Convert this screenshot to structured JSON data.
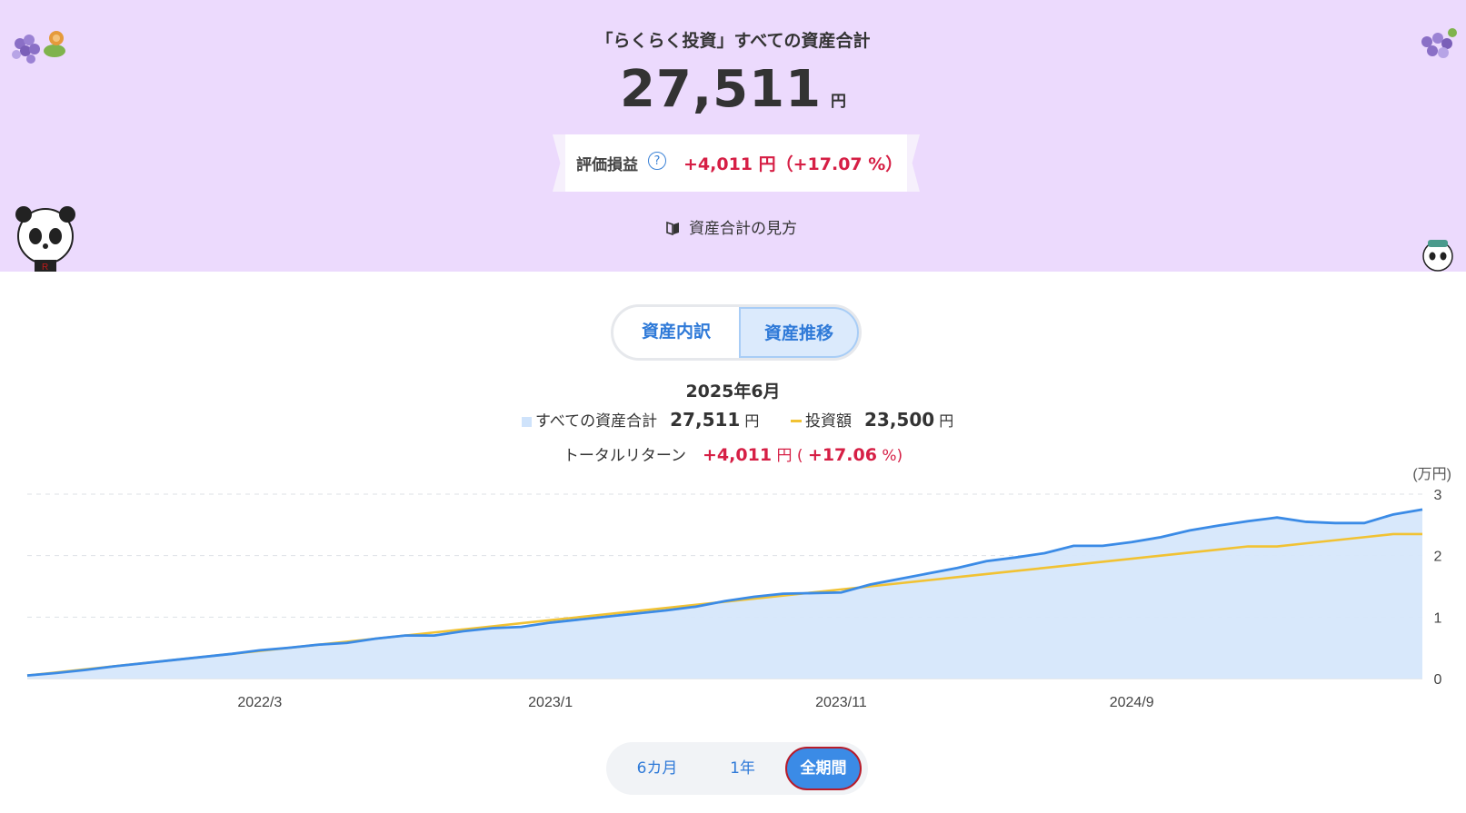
{
  "header": {
    "title": "「らくらく投資」すべての資産合計",
    "total_amount": "27,511",
    "total_unit": "円",
    "gain_label": "評価損益",
    "gain_value": "+4,011 円（+17.07 %）",
    "guide_link": "資産合計の見方",
    "help_icon": "question-circle-icon",
    "book_icon": "book-icon"
  },
  "tabs": [
    {
      "label": "資産内訳",
      "selected": false
    },
    {
      "label": "資産推移",
      "selected": true
    }
  ],
  "summary": {
    "period": "2025年6月",
    "total_label": "すべての資産合計",
    "total_value": "27,511",
    "total_unit": "円",
    "invest_label": "投資額",
    "invest_value": "23,500",
    "invest_unit": "円",
    "return_label": "トータルリターン",
    "return_value": "+4,011",
    "return_unit": "円",
    "return_pct_open": "(",
    "return_pct": "+17.06",
    "return_pct_close": "%)"
  },
  "range": [
    {
      "label": "6カ月",
      "selected": false
    },
    {
      "label": "1年",
      "selected": false
    },
    {
      "label": "全期間",
      "selected": true
    }
  ],
  "colors": {
    "hero_bg": "#ecdafd",
    "accent": "#2f7ad8",
    "gain_red": "#d61f45",
    "asset_line": "#3b8be6",
    "asset_area": "#d6e7fb",
    "invest_line": "#f1c233"
  },
  "chart_data": {
    "type": "area",
    "unit_label": "(万円)",
    "ylim": [
      0,
      3
    ],
    "yticks": [
      "0",
      "1",
      "2",
      "3"
    ],
    "grid": true,
    "xtick_labels": [
      "2022/3",
      "2023/1",
      "2023/11",
      "2024/9"
    ],
    "series": [
      {
        "name": "すべての資産合計",
        "values": [
          0.05,
          0.09,
          0.14,
          0.2,
          0.25,
          0.3,
          0.35,
          0.4,
          0.46,
          0.5,
          0.55,
          0.58,
          0.65,
          0.7,
          0.7,
          0.77,
          0.82,
          0.84,
          0.91,
          0.96,
          1.01,
          1.06,
          1.11,
          1.17,
          1.26,
          1.33,
          1.38,
          1.39,
          1.4,
          1.53,
          1.62,
          1.71,
          1.8,
          1.91,
          1.97,
          2.04,
          2.16,
          2.16,
          2.22,
          2.3,
          2.41,
          2.49,
          2.56,
          2.62,
          2.55,
          2.53,
          2.53,
          2.67,
          2.75
        ]
      },
      {
        "name": "投資額",
        "values": [
          0.05,
          0.1,
          0.15,
          0.2,
          0.25,
          0.3,
          0.35,
          0.4,
          0.45,
          0.5,
          0.55,
          0.6,
          0.65,
          0.7,
          0.75,
          0.8,
          0.85,
          0.9,
          0.95,
          1.0,
          1.05,
          1.1,
          1.15,
          1.2,
          1.25,
          1.3,
          1.35,
          1.4,
          1.45,
          1.5,
          1.55,
          1.6,
          1.65,
          1.7,
          1.75,
          1.8,
          1.85,
          1.9,
          1.95,
          2.0,
          2.05,
          2.1,
          2.15,
          2.15,
          2.2,
          2.25,
          2.3,
          2.35,
          2.35
        ]
      }
    ]
  }
}
